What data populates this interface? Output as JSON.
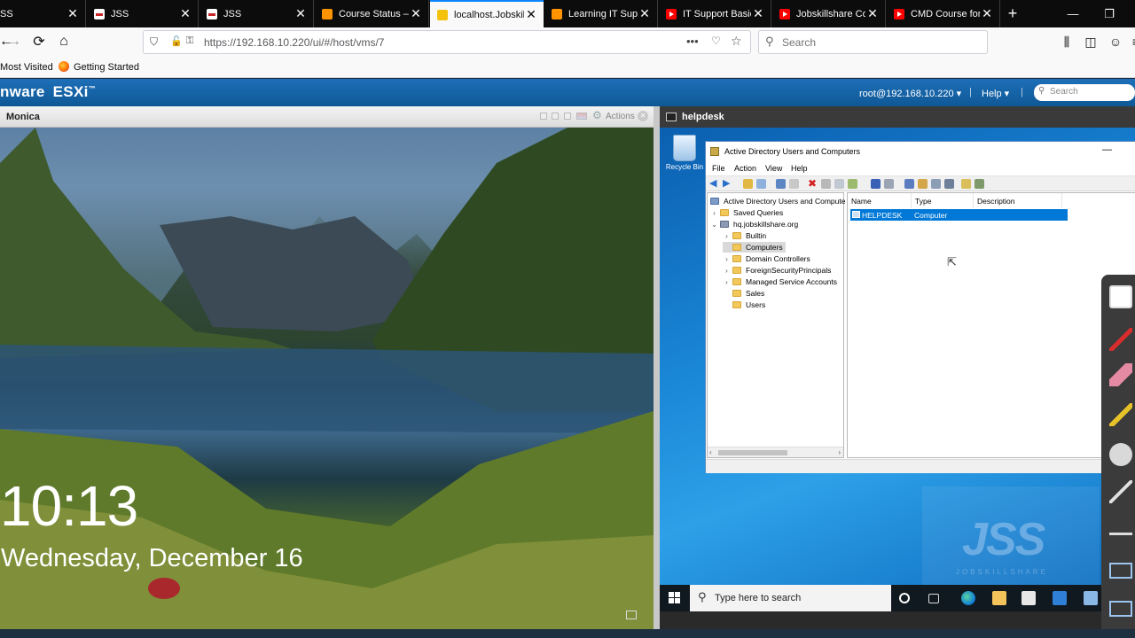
{
  "browser": {
    "tabs": [
      {
        "title": "SS",
        "icon": "jss-favicon"
      },
      {
        "title": "JSS",
        "icon": "jss-favicon"
      },
      {
        "title": "JSS",
        "icon": "jss-favicon"
      },
      {
        "title": "Course Status – J",
        "icon": "doc-favicon"
      },
      {
        "title": "localhost.Jobskill",
        "icon": "localhost-favicon",
        "active": true
      },
      {
        "title": "Learning IT Supp",
        "icon": "doc-favicon"
      },
      {
        "title": "IT Support Basic",
        "icon": "youtube-favicon"
      },
      {
        "title": "Jobskillshare Co",
        "icon": "youtube-favicon"
      },
      {
        "title": "CMD Course for",
        "icon": "youtube-favicon"
      }
    ],
    "new_tab": "+",
    "window_controls": {
      "minimize": "—",
      "maximize": "❐"
    },
    "url": "https://192.168.10.220/ui/#/host/vms/7",
    "search_placeholder": "Search",
    "bookmarks": [
      "Most Visited",
      "Getting Started"
    ]
  },
  "esxi": {
    "logo": "nware",
    "product": "ESXi",
    "trademark": "™",
    "user_menu": "root@192.168.10.220 ▾",
    "help_menu": "Help ▾",
    "separator": "|",
    "search_placeholder": "Search"
  },
  "console_left": {
    "vm_name": "Monica",
    "actions_label": "Actions",
    "lock_time": "10:13",
    "lock_date": "Wednesday, December 16"
  },
  "console_right": {
    "vm_name": "helpdesk",
    "recycle_bin": "Recycle Bin",
    "aduc": {
      "title": "Active Directory Users and Computers",
      "menu": [
        "File",
        "Action",
        "View",
        "Help"
      ],
      "tree": [
        {
          "label": "Active Directory Users and Compute",
          "level": 0
        },
        {
          "label": "Saved Queries",
          "level": 1,
          "expander": "›"
        },
        {
          "label": "hq.jobskillshare.org",
          "level": 1,
          "expander": "⌄"
        },
        {
          "label": "Builtin",
          "level": 2,
          "expander": "›"
        },
        {
          "label": "Computers",
          "level": 2,
          "selected": true
        },
        {
          "label": "Domain Controllers",
          "level": 2,
          "expander": "›"
        },
        {
          "label": "ForeignSecurityPrincipals",
          "level": 2,
          "expander": "›"
        },
        {
          "label": "Managed Service Accounts",
          "level": 2,
          "expander": "›"
        },
        {
          "label": "Sales",
          "level": 2
        },
        {
          "label": "Users",
          "level": 2
        }
      ],
      "columns": [
        "Name",
        "Type",
        "Description"
      ],
      "rows": [
        {
          "name": "HELPDESK",
          "type": "Computer",
          "description": ""
        }
      ]
    },
    "taskbar_search": "Type here to search",
    "watermark": {
      "logo": "JSS",
      "sub": "JOBSKILLSHARE"
    }
  },
  "colors": {
    "esxi_header": "#1d6fb8",
    "selection": "#0078d7",
    "active_tab_accent": "#0a84ff"
  }
}
